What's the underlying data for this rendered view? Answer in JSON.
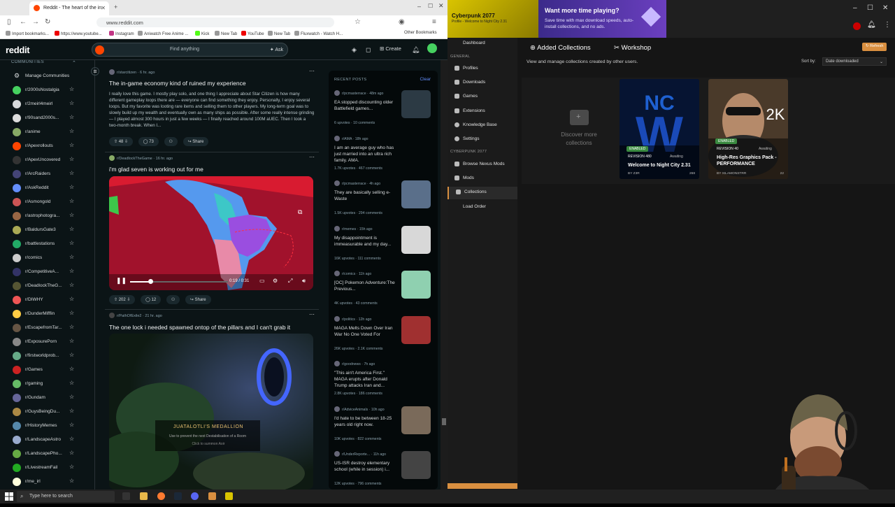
{
  "browser": {
    "tab_title": "Reddit - The heart of the in",
    "url": "www.reddit.com",
    "bookmarks": [
      "Import bookmarks...",
      "https://www.youtube...",
      "Instagram",
      "Aniwatch Free Anime ...",
      "Kick",
      "New Tab",
      "YouTube",
      "New Tab",
      "Fluxwatch - Watch H..."
    ],
    "other_bookmarks": "Other Bookmarks"
  },
  "reddit": {
    "logo": "reddit",
    "search_placeholder": "Find anything",
    "ask_label": "Ask",
    "create_label": "Create",
    "communities_head": "COMMUNITIES",
    "manage_label": "Manage Communities",
    "subs": [
      "r/2000sNostalgia",
      "r/2meirl4meirl",
      "r/90sand2000s...",
      "r/anime",
      "r/Apexrollouts",
      "r/ApexUncovered",
      "r/ArcRaiders",
      "r/AskReddit",
      "r/Asmongold",
      "r/astrophotogra...",
      "r/BaldursGate3",
      "r/battlestations",
      "r/comics",
      "r/CompetitiveA...",
      "r/DeadlockTheG...",
      "r/DIWHY",
      "r/DunderMifflin",
      "r/EscapefromTar...",
      "r/ExposurePorn",
      "r/firstworldprob...",
      "r/Games",
      "r/gaming",
      "r/Gundam",
      "r/GuysBeingDu...",
      "r/HistoryMemes",
      "r/LandscapeAstro",
      "r/LandscapePho...",
      "r/LivestreamFail",
      "r/me_irl"
    ]
  },
  "feed": {
    "posts": [
      {
        "sub": "r/starcitizen",
        "time": "6 hr. ago",
        "title": "The in-game economy kind of ruined my experience",
        "body": "I really love this game. I mostly play solo, and one thing I appreciate about Star Citizen is how many different gameplay loops there are — everyone can find something they enjoy. Personally, I enjoy several loops. But my favorite was looting rare items and selling them to other players. My long-term goal was to slowly build up my wealth and eventually own as many ships as possible. After some really intense grinding — I played almost 300 hours in just a few weeks — I finally reached around 100M aUEC. Then I took a two-month break. When I...",
        "votes": "48",
        "comments": "73",
        "share": "Share"
      },
      {
        "sub": "r/DeadlockTheGame",
        "time": "16 hr. ago",
        "title": "i'm glad seven is working out for me",
        "video_time": "0:19 / 0:31",
        "votes": "202",
        "comments": "12",
        "share": "Share"
      },
      {
        "sub": "r/PathOfExile2",
        "time": "21 hr. ago",
        "title": "The one lock i needed spawned ontop of the pillars and I can't grab it",
        "overlay_title": "JUATALOTLI'S MEDALLION",
        "overlay_sub": "Use to prevent the next Destabilisation of a Room",
        "overlay_hint": "Click to summon Aoir"
      }
    ]
  },
  "recent": {
    "head": "RECENT POSTS",
    "clear": "Clear",
    "items": [
      {
        "sub": "r/pcmasterrace",
        "time": "48m ago",
        "title": "EA stopped discounting older Battlefield games...",
        "upvotes": "6 upvotes",
        "comments": "10 comments",
        "color": "#2c3a44"
      },
      {
        "sub": "r/AMA",
        "time": "18h ago",
        "title": "I am an average guy who has just married into an ultra rich family. AMA.",
        "upvotes": "1.7K upvotes",
        "comments": "467 comments",
        "color": ""
      },
      {
        "sub": "r/pcmasterrace",
        "time": "4h ago",
        "title": "They are basically selling e-Waste",
        "upvotes": "1.5K upvotes",
        "comments": "294 comments",
        "color": "#5a6f8a"
      },
      {
        "sub": "r/memes",
        "time": "15h ago",
        "title": "My disappointment is immeasurable and my day...",
        "upvotes": "16K upvotes",
        "comments": "111 comments",
        "color": "#d8d8d8"
      },
      {
        "sub": "r/comics",
        "time": "11h ago",
        "title": "[OC] Pokemon Adventure:The Previous...",
        "upvotes": "4K upvotes",
        "comments": "43 comments",
        "color": "#8fd0b0"
      },
      {
        "sub": "r/politics",
        "time": "12h ago",
        "title": "MAGA Melts Down Over Iran War No One Voted For",
        "upvotes": "26K upvotes",
        "comments": "2.1K comments",
        "color": "#a03030"
      },
      {
        "sub": "r/goodnews",
        "time": "7h ago",
        "title": "\"This ain't America First.\" MAGA erupts after Donald Trump attacks Iran and...",
        "upvotes": "2.8K upvotes",
        "comments": "186 comments",
        "color": ""
      },
      {
        "sub": "r/AdviceAnimals",
        "time": "10h ago",
        "title": "I'd hate to be between 18-25 years old right now.",
        "upvotes": "10K upvotes",
        "comments": "822 comments",
        "color": "#7a6a5a"
      },
      {
        "sub": "r/UnderReporte...",
        "time": "11h ago",
        "title": "US-ISR destroy elementary school (while in session) i...",
        "upvotes": "12K upvotes",
        "comments": "796 comments",
        "color": "#444"
      }
    ]
  },
  "vortex": {
    "game_title": "Cyberpunk 2077",
    "game_sub": "Profile - Welcome to Night City 2.31",
    "promo_title": "Want more time playing?",
    "promo_body": "Save time with max download speeds, auto-install collections, and no ads.",
    "nav": {
      "dashboard": "Dashboard",
      "general_head": "GENERAL",
      "profiles": "Profiles",
      "downloads": "Downloads",
      "games": "Games",
      "extensions": "Extensions",
      "knowledge": "Knowledge Base",
      "settings": "Settings",
      "game_head": "CYBERPUNK 2077",
      "browse": "Browse Nexus Mods",
      "mods": "Mods",
      "collections": "Collections",
      "load_order": "Load Order"
    },
    "tabs": {
      "added": "Added Collections",
      "workshop": "Workshop"
    },
    "refresh": "Refresh",
    "description": "View and manage collections created by other users.",
    "sort_label": "Sort by:",
    "sort_value": "Date downloaded",
    "discover": "Discover more collections",
    "cards": [
      {
        "badge": "ENABLED",
        "revision": "REVISION 480",
        "status": "Awaiting",
        "title": "Welcome to Night City 2.31",
        "by": "BY Z3R",
        "version": "268"
      },
      {
        "badge": "ENABLED",
        "revision": "REVISION 40",
        "status": "Awaiting",
        "title": "High-Res Graphics Pack - PERFORMANCE",
        "by": "BY XILAMONSTRR",
        "version": "22"
      }
    ]
  },
  "taskbar": {
    "search": "Type here to search"
  },
  "colors": {
    "reddit_bg": "#0b1416",
    "reddit_accent": "#ff4500",
    "vortex_accent": "#d98f40",
    "enabled_green": "#3a8a40"
  }
}
